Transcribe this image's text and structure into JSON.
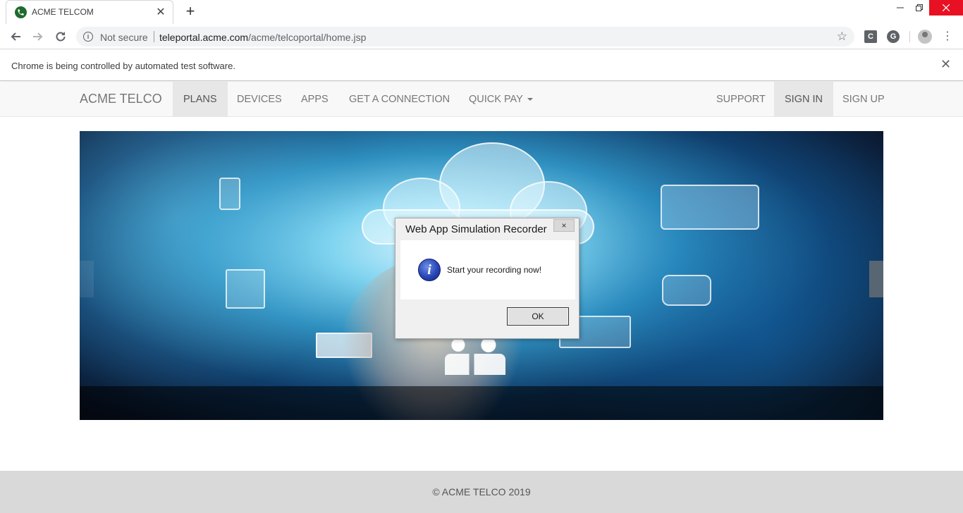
{
  "browser": {
    "tab_title": "ACME TELCOM",
    "new_tab": "+",
    "not_secure": "Not secure",
    "url_host": "teleportal.acme.com",
    "url_path": "/acme/telcoportal/home.jsp",
    "infobar_text": "Chrome is being controlled by automated test software.",
    "ext1_letter": "C",
    "ext2_letter": "G"
  },
  "navbar": {
    "brand": "ACME TELCO",
    "items": [
      {
        "label": "PLANS",
        "active": true
      },
      {
        "label": "DEVICES"
      },
      {
        "label": "APPS"
      },
      {
        "label": "GET A CONNECTION"
      },
      {
        "label": "QUICK PAY"
      }
    ],
    "right_items": [
      {
        "label": "SUPPORT"
      },
      {
        "label": "SIGN IN",
        "active": true
      },
      {
        "label": "SIGN UP"
      }
    ]
  },
  "dialog": {
    "title": "Web App Simulation Recorder",
    "message": "Start your recording now!",
    "ok_label": "OK",
    "close_label": "×"
  },
  "footer": {
    "text": "© ACME TELCO 2019"
  },
  "colors": {
    "window_close": "#e81123",
    "navbar_bg": "#f8f8f8",
    "footer_bg": "#d9d9d9"
  }
}
